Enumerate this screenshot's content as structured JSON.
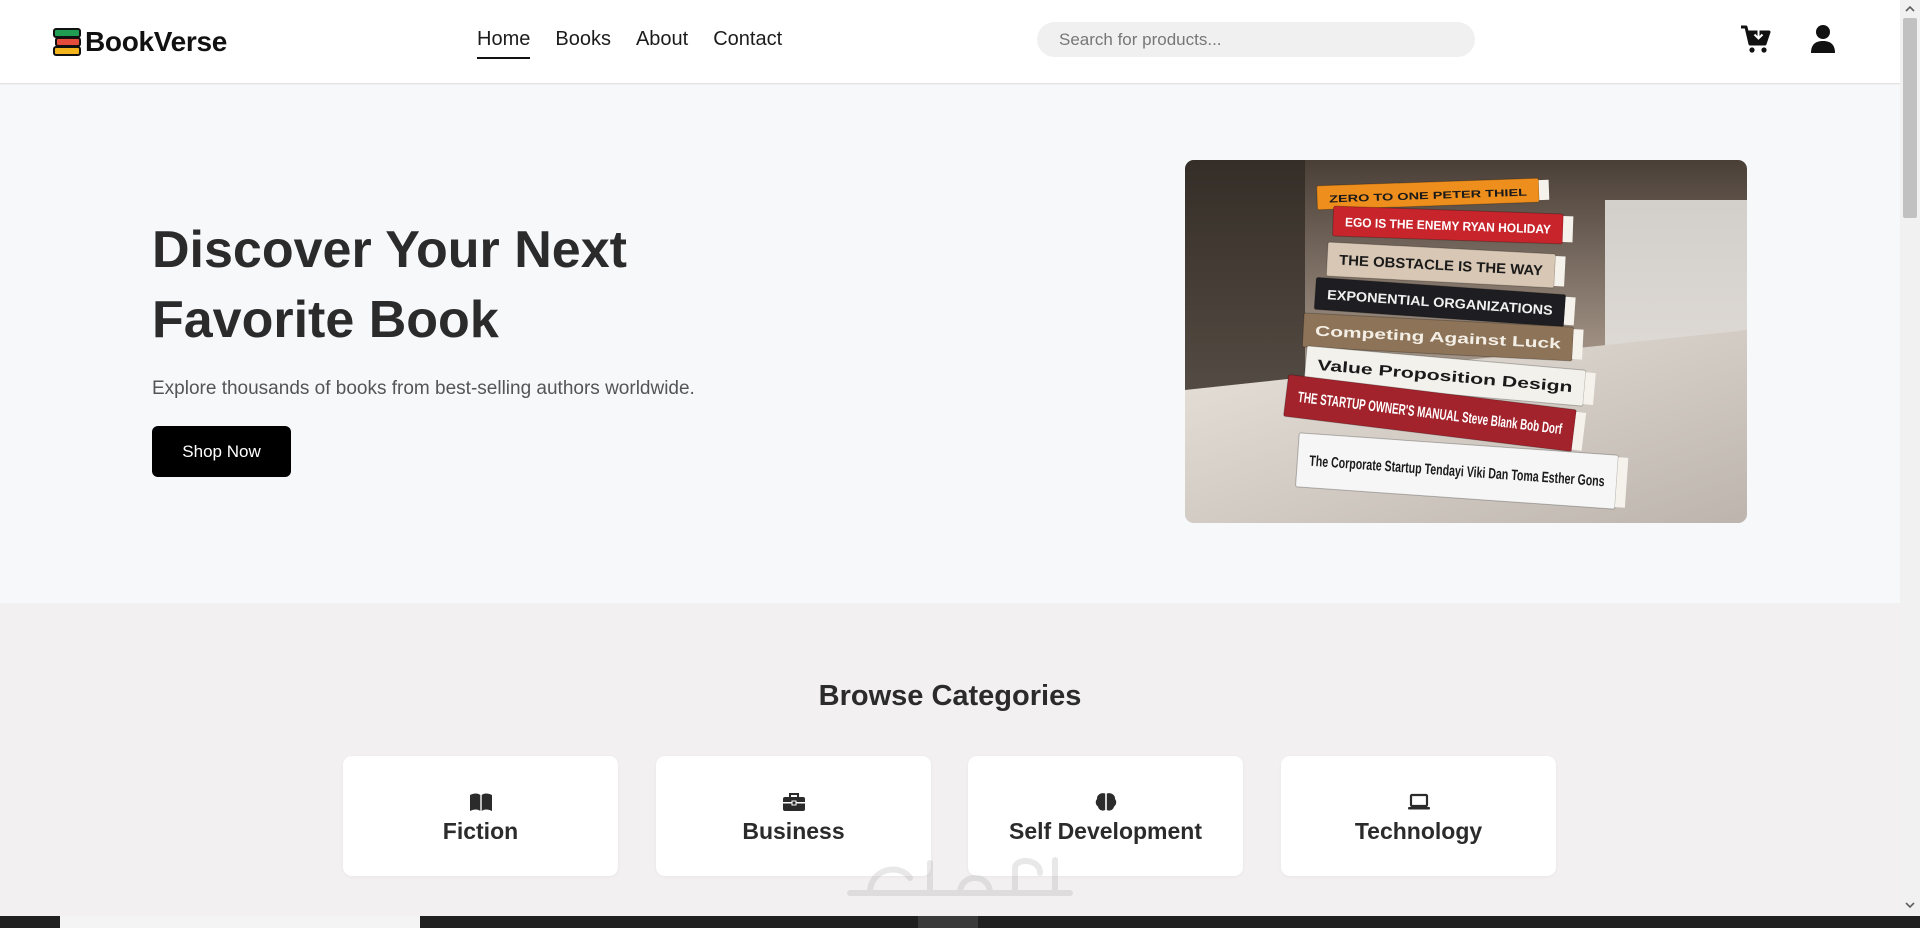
{
  "brand": {
    "name": "BookVerse"
  },
  "nav": {
    "items": [
      {
        "label": "Home",
        "active": true
      },
      {
        "label": "Books",
        "active": false
      },
      {
        "label": "About",
        "active": false
      },
      {
        "label": "Contact",
        "active": false
      }
    ]
  },
  "search": {
    "placeholder": "Search for products...",
    "value": ""
  },
  "header_icons": {
    "cart": "cart-icon",
    "user": "user-icon"
  },
  "hero": {
    "title": "Discover Your Next Favorite Book",
    "subtitle": "Explore thousands of books from best-selling authors worldwide.",
    "cta_label": "Shop Now",
    "image": {
      "books": [
        {
          "spine": "ZERO TO ONE   PETER THIEL",
          "color": "#ee8e1c",
          "text_color": "#1a1a1a"
        },
        {
          "spine": "EGO IS THE ENEMY   RYAN HOLIDAY",
          "color": "#c8242b",
          "text_color": "#ffffff"
        },
        {
          "spine": "THE OBSTACLE IS THE WAY",
          "color": "#d8c7b4",
          "text_color": "#1a1a1a"
        },
        {
          "spine": "EXPONENTIAL ORGANIZATIONS",
          "color": "#1e1e22",
          "text_color": "#f1f1f1"
        },
        {
          "spine": "Competing Against Luck",
          "color": "#8d7358",
          "text_color": "#f4efe6"
        },
        {
          "spine": "Value Proposition Design",
          "color": "#f3f1ec",
          "text_color": "#1a1a1a"
        },
        {
          "spine": "THE STARTUP OWNER'S MANUAL   Steve Blank Bob Dorf",
          "color": "#a3232c",
          "text_color": "#ffffff"
        },
        {
          "spine": "The Corporate Startup   Tendayi Viki Dan Toma Esther Gons",
          "color": "#f6f6f6",
          "text_color": "#1a1a1a"
        }
      ]
    }
  },
  "categories": {
    "title": "Browse Categories",
    "items": [
      {
        "label": "Fiction",
        "icon": "book-open-icon"
      },
      {
        "label": "Business",
        "icon": "briefcase-icon"
      },
      {
        "label": "Self Development",
        "icon": "brain-icon"
      },
      {
        "label": "Technology",
        "icon": "laptop-icon"
      }
    ]
  },
  "colors": {
    "header_bg": "#ffffff",
    "hero_bg": "#f7f8fa",
    "section_bg": "#f2f0f0",
    "primary_button": "#000000",
    "text_dark": "#2b2b2b"
  }
}
